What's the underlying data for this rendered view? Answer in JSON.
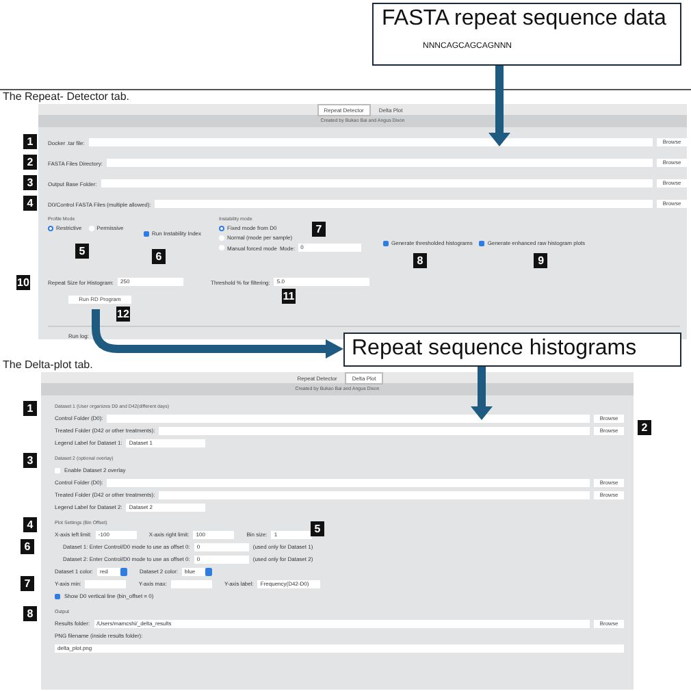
{
  "callouts": [
    {
      "title": "FASTA repeat sequence data",
      "subtitle": "NNNCAGCAGCAGNNN"
    },
    {
      "title": "Repeat sequence histograms"
    }
  ],
  "repeat_detector": {
    "caption": "The Repeat- Detector tab.",
    "tabs": [
      {
        "label": "Repeat Detector",
        "selected": true
      },
      {
        "label": "Delta Plot",
        "selected": false
      }
    ],
    "credit": "Created by Bukao Bai and Angus Dixon",
    "file_rows": [
      {
        "label": "Docker .tar file:",
        "button": "Browse",
        "badge": "1"
      },
      {
        "label": "FASTA Files Directory:",
        "button": "Browse",
        "badge": "2"
      },
      {
        "label": "Output Base Folder:",
        "button": "Browse",
        "badge": "3"
      },
      {
        "label": "D0/Control FASTA Files (multiple allowed):",
        "button": "Browse",
        "badge": "4"
      }
    ],
    "profile_mode": {
      "title": "Profile Mode",
      "badge": "5",
      "options": [
        {
          "label": "Restrictive",
          "selected": true
        },
        {
          "label": "Permissive",
          "selected": false
        }
      ]
    },
    "instability_index": {
      "label": "Run Instability Index",
      "checked": true,
      "badge": "6"
    },
    "instability_mode": {
      "title": "Instability mode",
      "badge": "7",
      "mode_label": "Mode:",
      "mode_value": "0",
      "options": [
        {
          "label": "Fixed mode from D0",
          "selected": true
        },
        {
          "label": "Normal (mode per sample)",
          "selected": false
        },
        {
          "label": "Manual forced mode",
          "selected": false
        }
      ]
    },
    "histogram_options": [
      {
        "label": "Generate thresholded histograms",
        "checked": true,
        "badge": "8"
      },
      {
        "label": "Generate enhanced raw histogram plots",
        "checked": true,
        "badge": "9"
      }
    ],
    "numeric_fields": [
      {
        "label": "Repeat Size for Histogram:",
        "value": "250",
        "badge": "10"
      },
      {
        "label": "Threshold % for filtering:",
        "value": "5.0",
        "badge": "11"
      }
    ],
    "run_button": {
      "label": "Run RD Program",
      "badge": "12"
    },
    "run_log_label": "Run log:"
  },
  "delta_plot": {
    "caption": "The Delta-plot tab.",
    "tabs": [
      {
        "label": "Repeat Detector",
        "selected": false
      },
      {
        "label": "Delta Plot",
        "selected": true
      }
    ],
    "credit": "Created by Bukao Bai and Angus Dixon",
    "sections": [
      {
        "title": "Dataset 1 (User organizes D0 and D42(different days)",
        "badge": "1",
        "rows": [
          {
            "kind": "file",
            "label": "Control Folder (D0):",
            "button": "Browse"
          },
          {
            "kind": "file",
            "label": "Treated Folder (D42 or other treatments):",
            "button": "Browse",
            "badge": "2"
          },
          {
            "kind": "field",
            "label": "Legend Label for Dataset 1:",
            "value": "Dataset 1"
          }
        ]
      },
      {
        "title": "Dataset 2 (optional overlay)",
        "badge": "3",
        "rows": [
          {
            "kind": "checkbox",
            "label": "Enable Dataset 2 overlay",
            "checked": false
          },
          {
            "kind": "file",
            "label": "Control Folder (D0):",
            "button": "Browse"
          },
          {
            "kind": "file",
            "label": "Treated Folder (D42 or other treatments):",
            "button": "Browse"
          },
          {
            "kind": "field",
            "label": "Legend Label for Dataset 2:",
            "value": "Dataset 2"
          }
        ]
      },
      {
        "title": "Plot Settings (Bin Offset)",
        "badge": "4",
        "rows": [
          {
            "kind": "fields",
            "badge": "5",
            "items": [
              {
                "label": "X-axis left limit:",
                "value": "-100"
              },
              {
                "label": "X-axis right limit:",
                "value": "100"
              },
              {
                "label": "Bin size:",
                "value": "1"
              }
            ]
          },
          {
            "kind": "offset",
            "badge": "6",
            "label": "Dataset 1: Enter Control/D0 mode to use as offset 0:",
            "value": "0",
            "note": "(used only for Dataset 1)"
          },
          {
            "kind": "offset",
            "label": "Dataset 2: Enter Control/D0 mode to use as offset 0:",
            "value": "0",
            "note": "(used only for Dataset 2)"
          },
          {
            "kind": "selects",
            "items": [
              {
                "label": "Dataset 1 color:",
                "value": "red"
              },
              {
                "label": "Dataset 2 color:",
                "value": "blue"
              }
            ]
          },
          {
            "kind": "fields",
            "badge": "7",
            "items": [
              {
                "label": "Y-axis min:"
              },
              {
                "label": "Y-axis max:"
              },
              {
                "label": "Y-axis label:",
                "value": "Frequency(D42-D0)"
              }
            ]
          },
          {
            "kind": "checkbox",
            "label": "Show D0 vertical line (bin_offset = 0)",
            "checked": true
          }
        ]
      },
      {
        "title": "Output",
        "badge": "8",
        "rows": [
          {
            "kind": "file",
            "label": "Results folder:",
            "value": "/Users/mamcshi/_delta_results",
            "button": "Browse"
          },
          {
            "kind": "label",
            "label": "PNG filename (inside results folder):"
          },
          {
            "kind": "wide",
            "value": "delta_plot.png"
          }
        ]
      }
    ]
  }
}
